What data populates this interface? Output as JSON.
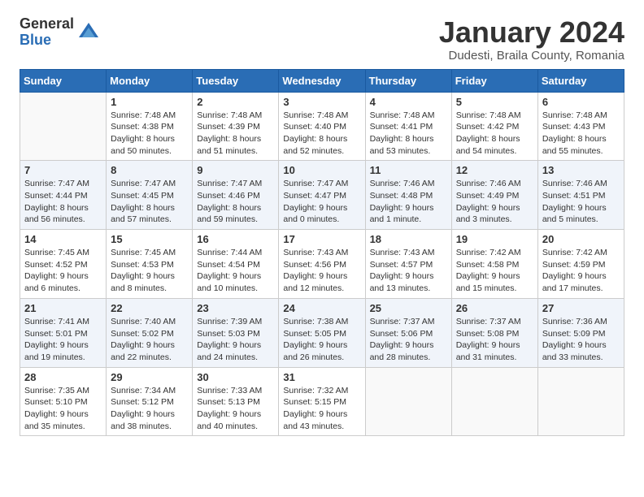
{
  "header": {
    "logo_general": "General",
    "logo_blue": "Blue",
    "month_title": "January 2024",
    "subtitle": "Dudesti, Braila County, Romania"
  },
  "days_of_week": [
    "Sunday",
    "Monday",
    "Tuesday",
    "Wednesday",
    "Thursday",
    "Friday",
    "Saturday"
  ],
  "weeks": [
    [
      {
        "day": "",
        "info": ""
      },
      {
        "day": "1",
        "info": "Sunrise: 7:48 AM\nSunset: 4:38 PM\nDaylight: 8 hours\nand 50 minutes."
      },
      {
        "day": "2",
        "info": "Sunrise: 7:48 AM\nSunset: 4:39 PM\nDaylight: 8 hours\nand 51 minutes."
      },
      {
        "day": "3",
        "info": "Sunrise: 7:48 AM\nSunset: 4:40 PM\nDaylight: 8 hours\nand 52 minutes."
      },
      {
        "day": "4",
        "info": "Sunrise: 7:48 AM\nSunset: 4:41 PM\nDaylight: 8 hours\nand 53 minutes."
      },
      {
        "day": "5",
        "info": "Sunrise: 7:48 AM\nSunset: 4:42 PM\nDaylight: 8 hours\nand 54 minutes."
      },
      {
        "day": "6",
        "info": "Sunrise: 7:48 AM\nSunset: 4:43 PM\nDaylight: 8 hours\nand 55 minutes."
      }
    ],
    [
      {
        "day": "7",
        "info": "Sunrise: 7:47 AM\nSunset: 4:44 PM\nDaylight: 8 hours\nand 56 minutes."
      },
      {
        "day": "8",
        "info": "Sunrise: 7:47 AM\nSunset: 4:45 PM\nDaylight: 8 hours\nand 57 minutes."
      },
      {
        "day": "9",
        "info": "Sunrise: 7:47 AM\nSunset: 4:46 PM\nDaylight: 8 hours\nand 59 minutes."
      },
      {
        "day": "10",
        "info": "Sunrise: 7:47 AM\nSunset: 4:47 PM\nDaylight: 9 hours\nand 0 minutes."
      },
      {
        "day": "11",
        "info": "Sunrise: 7:46 AM\nSunset: 4:48 PM\nDaylight: 9 hours\nand 1 minute."
      },
      {
        "day": "12",
        "info": "Sunrise: 7:46 AM\nSunset: 4:49 PM\nDaylight: 9 hours\nand 3 minutes."
      },
      {
        "day": "13",
        "info": "Sunrise: 7:46 AM\nSunset: 4:51 PM\nDaylight: 9 hours\nand 5 minutes."
      }
    ],
    [
      {
        "day": "14",
        "info": "Sunrise: 7:45 AM\nSunset: 4:52 PM\nDaylight: 9 hours\nand 6 minutes."
      },
      {
        "day": "15",
        "info": "Sunrise: 7:45 AM\nSunset: 4:53 PM\nDaylight: 9 hours\nand 8 minutes."
      },
      {
        "day": "16",
        "info": "Sunrise: 7:44 AM\nSunset: 4:54 PM\nDaylight: 9 hours\nand 10 minutes."
      },
      {
        "day": "17",
        "info": "Sunrise: 7:43 AM\nSunset: 4:56 PM\nDaylight: 9 hours\nand 12 minutes."
      },
      {
        "day": "18",
        "info": "Sunrise: 7:43 AM\nSunset: 4:57 PM\nDaylight: 9 hours\nand 13 minutes."
      },
      {
        "day": "19",
        "info": "Sunrise: 7:42 AM\nSunset: 4:58 PM\nDaylight: 9 hours\nand 15 minutes."
      },
      {
        "day": "20",
        "info": "Sunrise: 7:42 AM\nSunset: 4:59 PM\nDaylight: 9 hours\nand 17 minutes."
      }
    ],
    [
      {
        "day": "21",
        "info": "Sunrise: 7:41 AM\nSunset: 5:01 PM\nDaylight: 9 hours\nand 19 minutes."
      },
      {
        "day": "22",
        "info": "Sunrise: 7:40 AM\nSunset: 5:02 PM\nDaylight: 9 hours\nand 22 minutes."
      },
      {
        "day": "23",
        "info": "Sunrise: 7:39 AM\nSunset: 5:03 PM\nDaylight: 9 hours\nand 24 minutes."
      },
      {
        "day": "24",
        "info": "Sunrise: 7:38 AM\nSunset: 5:05 PM\nDaylight: 9 hours\nand 26 minutes."
      },
      {
        "day": "25",
        "info": "Sunrise: 7:37 AM\nSunset: 5:06 PM\nDaylight: 9 hours\nand 28 minutes."
      },
      {
        "day": "26",
        "info": "Sunrise: 7:37 AM\nSunset: 5:08 PM\nDaylight: 9 hours\nand 31 minutes."
      },
      {
        "day": "27",
        "info": "Sunrise: 7:36 AM\nSunset: 5:09 PM\nDaylight: 9 hours\nand 33 minutes."
      }
    ],
    [
      {
        "day": "28",
        "info": "Sunrise: 7:35 AM\nSunset: 5:10 PM\nDaylight: 9 hours\nand 35 minutes."
      },
      {
        "day": "29",
        "info": "Sunrise: 7:34 AM\nSunset: 5:12 PM\nDaylight: 9 hours\nand 38 minutes."
      },
      {
        "day": "30",
        "info": "Sunrise: 7:33 AM\nSunset: 5:13 PM\nDaylight: 9 hours\nand 40 minutes."
      },
      {
        "day": "31",
        "info": "Sunrise: 7:32 AM\nSunset: 5:15 PM\nDaylight: 9 hours\nand 43 minutes."
      },
      {
        "day": "",
        "info": ""
      },
      {
        "day": "",
        "info": ""
      },
      {
        "day": "",
        "info": ""
      }
    ]
  ]
}
